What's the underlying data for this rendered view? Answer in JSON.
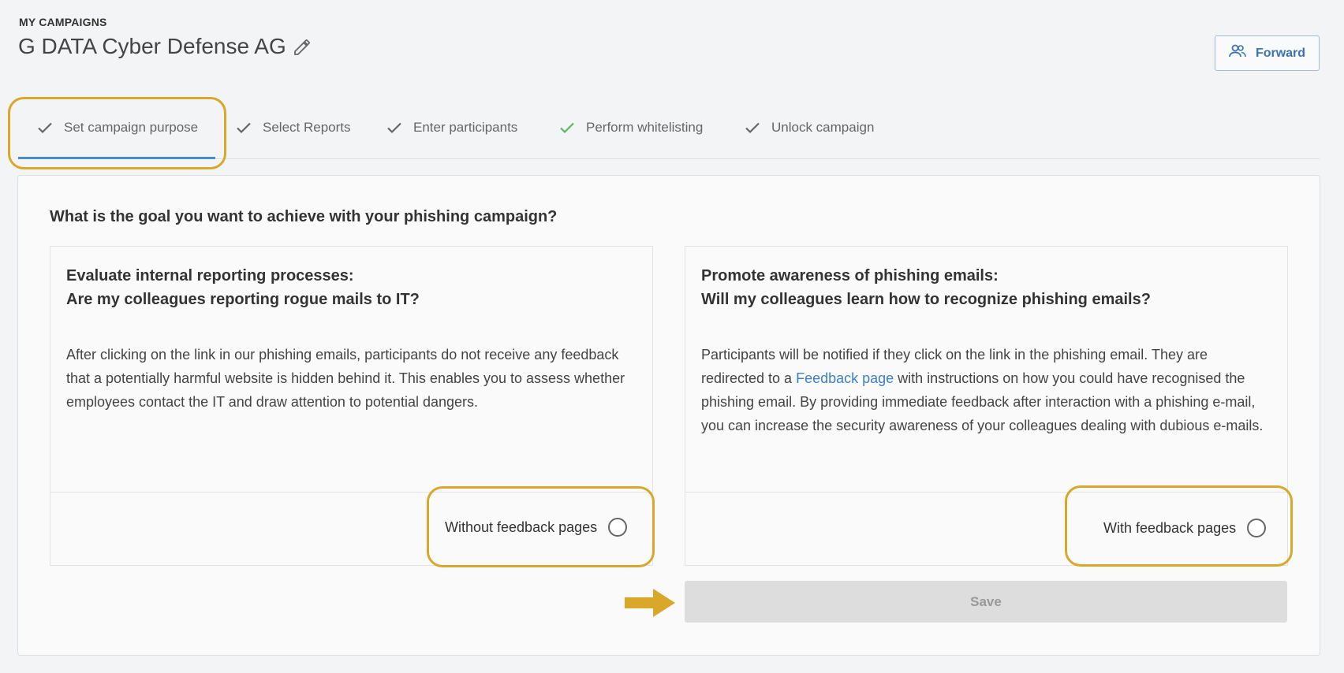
{
  "header": {
    "section_label": "MY CAMPAIGNS",
    "title": "G DATA Cyber Defense AG",
    "forward_label": "Forward"
  },
  "tabs": [
    {
      "label": "Set campaign purpose",
      "active": true,
      "check_color": "#666666"
    },
    {
      "label": "Select Reports",
      "active": false,
      "check_color": "#666666"
    },
    {
      "label": "Enter participants",
      "active": false,
      "check_color": "#666666"
    },
    {
      "label": "Perform whitelisting",
      "active": false,
      "check_color": "#5cb85c"
    },
    {
      "label": "Unlock campaign",
      "active": false,
      "check_color": "#666666"
    }
  ],
  "main": {
    "question": "What is the goal you want to achieve with your phishing campaign?",
    "cards": [
      {
        "heading_line1": "Evaluate internal reporting processes:",
        "heading_line2": "Are my colleagues reporting rogue mails to IT?",
        "body": "After clicking on the link in our phishing emails, participants do not receive any feedback that a potentially harmful website is hidden behind it. This enables you to assess whether employees contact the IT and draw attention to potential dangers.",
        "option_label": "Without feedback pages",
        "selected": false
      },
      {
        "heading_line1": "Promote awareness of phishing emails:",
        "heading_line2": "Will my colleagues learn how to recognize phishing emails?",
        "body_before_link": "Participants will be notified if they click on the link in the phishing email. They are redirected to a ",
        "body_link": "Feedback page",
        "body_after_link": " with instructions on how you could have recognised the phishing email. By providing immediate feedback after interaction with a phishing e-mail, you can increase the security awareness of your colleagues dealing with dubious e-mails.",
        "option_label": "With feedback pages",
        "selected": false
      }
    ],
    "save_label": "Save"
  },
  "colors": {
    "highlight": "#d9a82b",
    "accent": "#4a8ac9",
    "link": "#3d80c7",
    "save_disabled_bg": "#dddddd"
  }
}
